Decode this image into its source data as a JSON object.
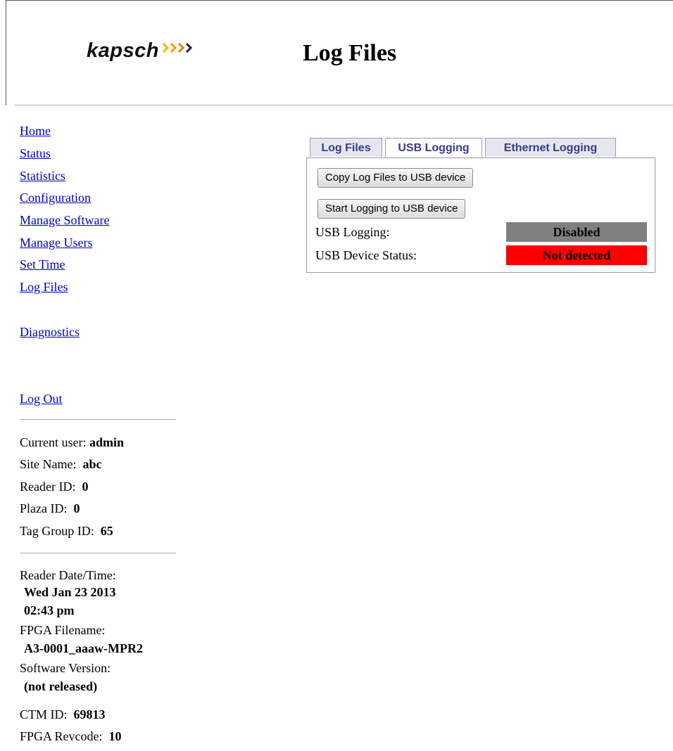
{
  "header": {
    "logo_text": "kapsch",
    "title": "Log Files"
  },
  "nav": {
    "items": [
      "Home",
      "Status",
      "Statistics",
      "Configuration",
      "Manage Software",
      "Manage Users",
      "Set Time",
      "Log Files"
    ],
    "diagnostics": "Diagnostics",
    "logout": "Log Out"
  },
  "info": {
    "current_user_label": "Current user:",
    "current_user": "admin",
    "site_name_label": "Site Name:",
    "site_name": "abc",
    "reader_id_label": "Reader ID:",
    "reader_id": "0",
    "plaza_id_label": "Plaza ID:",
    "plaza_id": "0",
    "tag_group_label": "Tag Group ID:",
    "tag_group": "65",
    "reader_datetime_label": "Reader Date/Time:",
    "reader_date": "Wed Jan 23 2013",
    "reader_time": "02:43 pm",
    "fpga_filename_label": "FPGA Filename:",
    "fpga_filename": "A3-0001_aaaw-MPR2",
    "software_version_label": "Software Version:",
    "software_version": "(not released)",
    "ctm_id_label": "CTM ID:",
    "ctm_id": "69813",
    "fpga_revcode_label": "FPGA Revcode:",
    "fpga_revcode": "10"
  },
  "tabs": [
    "Log Files",
    "USB Logging",
    "Ethernet Logging"
  ],
  "active_tab": "USB Logging",
  "panel": {
    "copy_button": "Copy Log Files to USB device",
    "start_button": "Start Logging to USB device",
    "usb_logging_label": "USB Logging:",
    "usb_logging_status": "Disabled",
    "usb_device_label": "USB Device Status:",
    "usb_device_status": "Not detected"
  },
  "colors": {
    "link": "#0000cc",
    "logo_chevron_gold": "#f2b705",
    "logo_chevron_orange": "#f07d00",
    "status_disabled": "#808080",
    "status_not_detected": "#ff0000",
    "tab_text": "#3a3a8c"
  }
}
